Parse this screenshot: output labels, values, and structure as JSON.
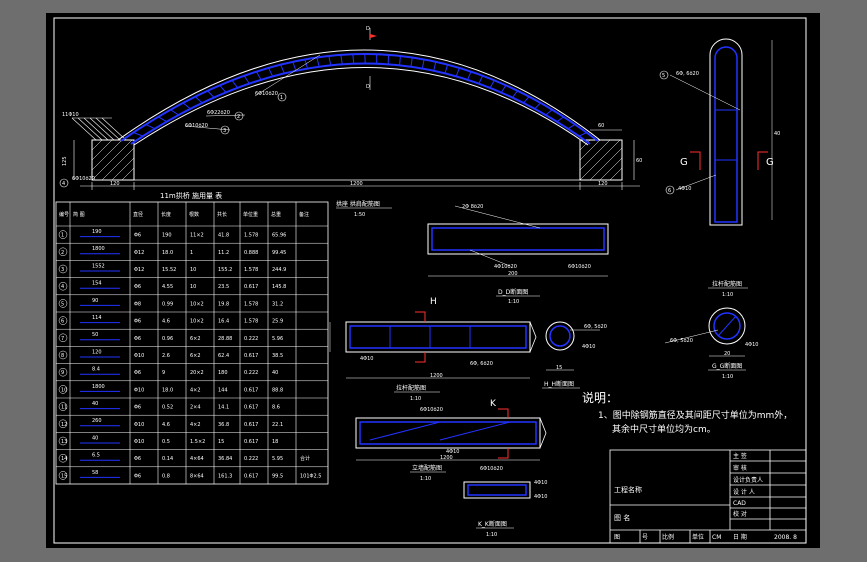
{
  "arch_view": {
    "title": "11m拱桥 施用量 表",
    "labels": {
      "rebar_top": "6Φ10ö20",
      "rebar_mid": "6Φ22ö20",
      "rebar_left": "11Φ10",
      "rebar_bottom": "6Φ10ö20",
      "dim_base_left": "120",
      "dim_base_right": "120",
      "dim_span": "1200",
      "dim_height_left": "125",
      "dim_top_right": "60",
      "dim_side_right": "60",
      "section_mark": "D"
    },
    "callouts": [
      "1",
      "2",
      "3",
      "4"
    ]
  },
  "g_section": {
    "labels": {
      "rebar_a": "6Φ, 6ö20",
      "rebar_b": "4Φ10",
      "g_left": "G",
      "g_right": "G",
      "dim_width": "20",
      "dim_height": "40"
    },
    "callouts": [
      "5",
      "6"
    ]
  },
  "mid_details": {
    "cap_beam_title": "拱座 拱肩配筋图",
    "cap_beam_scale": "1:50",
    "cap_rebar_a": "2Φ 8ö20",
    "cap_rebar_b": "4Φ10ö20",
    "cap_rebar_c": "6Φ10ö20",
    "cap_dim": "200",
    "dd_title": "D_D断面图",
    "dd_scale": "1:10",
    "tie_title": "拉杆配筋图",
    "tie_scale": "1:10",
    "tie_label_a": "4Φ10",
    "tie_label_b": "6Φ, 6ö20",
    "tie_dim": "1200",
    "h_mark": "H",
    "hh_title": "H_H断面图",
    "hh_dim": "15",
    "hh_rebar_a": "6Φ, 5ö20",
    "hh_rebar_b": "4Φ10",
    "lower_title": "立墙配筋图",
    "lower_scale": "1:10",
    "lower_rebar_a": "6Φ10ö20",
    "lower_rebar_b": "4Φ10",
    "lower_dim": "1200",
    "k_mark": "K",
    "kk_title": "K_K断面图",
    "kk_scale": "1:10",
    "kk_rebar_a": "6Φ10ö20",
    "kk_rebar_b": "4Φ10",
    "kk_rebar_c": "4Φ10",
    "g_title": "拉杆配筋图",
    "g_scale": "1:10",
    "gg_title": "G_G断面图",
    "gg_scale": "1:10",
    "gg_rebar_a": "6Φ, 5ö20",
    "gg_rebar_b": "4Φ10",
    "gg_dim": "20"
  },
  "notes": {
    "heading": "说明：",
    "line1": "1、图中除钢筋直径及其间距尺寸单位为mm外，",
    "line2": "其余中尺寸单位均为cm。"
  },
  "title_block": {
    "right_rows": [
      "主  签",
      "审  核",
      "设计负责人",
      "设  计  人",
      "CAD",
      "校  对",
      "日  期"
    ],
    "date_value": "2008. 8",
    "project_label": "工程名称",
    "drawing_label": "图   名",
    "bottom_labels": [
      "图",
      "号",
      "比例",
      "单位",
      "CM",
      "比例"
    ]
  },
  "schedule": {
    "headers": [
      "编号",
      "简  图",
      "直径",
      "长度",
      "根数",
      "共长",
      "单位重",
      "总重",
      "备注"
    ],
    "rows": [
      {
        "no": "1",
        "sketch": "190",
        "dia": "Φ6",
        "len": "190",
        "count": "11×2",
        "total": "41.8",
        "unit": "1.578",
        "weight": "65.96",
        "note": ""
      },
      {
        "no": "2",
        "sketch": "1800",
        "dia": "Φ12",
        "len": "18.0",
        "count": "1",
        "total": "11.2",
        "unit": "0.888",
        "weight": "99.45",
        "note": ""
      },
      {
        "no": "3",
        "sketch": "1552",
        "dia": "Φ12",
        "len": "15.52",
        "count": "10",
        "total": "155.2",
        "unit": "1.578",
        "weight": "244.9",
        "note": ""
      },
      {
        "no": "4",
        "sketch": "154",
        "dia": "Φ6",
        "len": "4.55",
        "count": "10",
        "total": "23.5",
        "unit": "0.617",
        "weight": "145.8",
        "note": ""
      },
      {
        "no": "5",
        "sketch": "90",
        "dia": "Φ8",
        "len": "0.99",
        "count": "10×2",
        "total": "19.8",
        "unit": "1.578",
        "weight": "31.2",
        "note": ""
      },
      {
        "no": "6",
        "sketch": "114",
        "dia": "Φ6",
        "len": "4.6",
        "count": "10×2",
        "total": "16.4",
        "unit": "1.578",
        "weight": "25.9",
        "note": ""
      },
      {
        "no": "7",
        "sketch": "50",
        "dia": "Φ6",
        "len": "0.96",
        "count": "6×2",
        "total": "28.88",
        "unit": "0.222",
        "weight": "5.96",
        "note": ""
      },
      {
        "no": "8",
        "sketch": "120",
        "dia": "Φ10",
        "len": "2.6",
        "count": "6×2",
        "total": "62.4",
        "unit": "0.617",
        "weight": "38.5",
        "note": ""
      },
      {
        "no": "9",
        "sketch": "8.4",
        "dia": "Φ6",
        "len": "9",
        "count": "20×2",
        "total": "180",
        "unit": "0.222",
        "weight": "40",
        "note": ""
      },
      {
        "no": "10",
        "sketch": "1800",
        "dia": "Φ10",
        "len": "18.0",
        "count": "4×2",
        "total": "144",
        "unit": "0.617",
        "weight": "88.8",
        "note": ""
      },
      {
        "no": "11",
        "sketch": "40",
        "dia": "Φ6",
        "len": "0.52",
        "count": "2×4",
        "total": "14.1",
        "unit": "0.617",
        "weight": "8.6",
        "note": ""
      },
      {
        "no": "12",
        "sketch": "260",
        "dia": "Φ10",
        "len": "4.6",
        "count": "4×2",
        "total": "36.8",
        "unit": "0.617",
        "weight": "22.1",
        "note": ""
      },
      {
        "no": "13",
        "sketch": "40",
        "dia": "Φ10",
        "len": "0.5",
        "count": "1.5×2",
        "total": "15",
        "unit": "0.617",
        "weight": "18",
        "note": ""
      },
      {
        "no": "14",
        "sketch": "6.5",
        "dia": "Φ6",
        "len": "0.14",
        "count": "4×64",
        "total": "36.84",
        "unit": "0.222",
        "weight": "5.95",
        "note": "合计"
      },
      {
        "no": "15",
        "sketch": "58",
        "dia": "Φ6",
        "len": "0.8",
        "count": "8×64",
        "total": "161.3",
        "unit": "0.617",
        "weight": "99.5",
        "note": "101Φ2.5"
      }
    ]
  }
}
